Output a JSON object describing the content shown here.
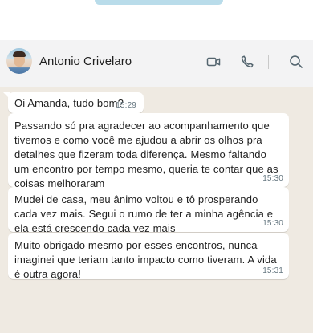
{
  "contact": {
    "name": "Antonio Crivelaro"
  },
  "header_icons": [
    "video-call-icon",
    "voice-call-icon",
    "search-icon"
  ],
  "messages": [
    {
      "text": "Oi Amanda, tudo bom?",
      "time": "15:29"
    },
    {
      "text": "Passando só pra agradecer ao acompanhamento que tivemos e como você me ajudou a abrir os olhos pra detalhes que fizeram toda diferença. Mesmo faltando um encontro por tempo mesmo, queria te contar que as coisas melhoraram",
      "time": "15:30"
    },
    {
      "text": "Mudei de casa, meu ânimo voltou e tô prosperando cada vez mais. Segui o rumo de ter a minha agência e ela está crescendo cada vez mais",
      "time": "15:30"
    },
    {
      "text": "Muito obrigado mesmo por esses encontros, nunca imaginei que teriam tanto impacto como tiveram. A vida é outra agora!",
      "time": "15:31"
    }
  ],
  "colors": {
    "chat_background": "#efeae2",
    "header_background": "#f3f3f4",
    "bubble": "#ffffff",
    "timestamp": "#667781"
  }
}
